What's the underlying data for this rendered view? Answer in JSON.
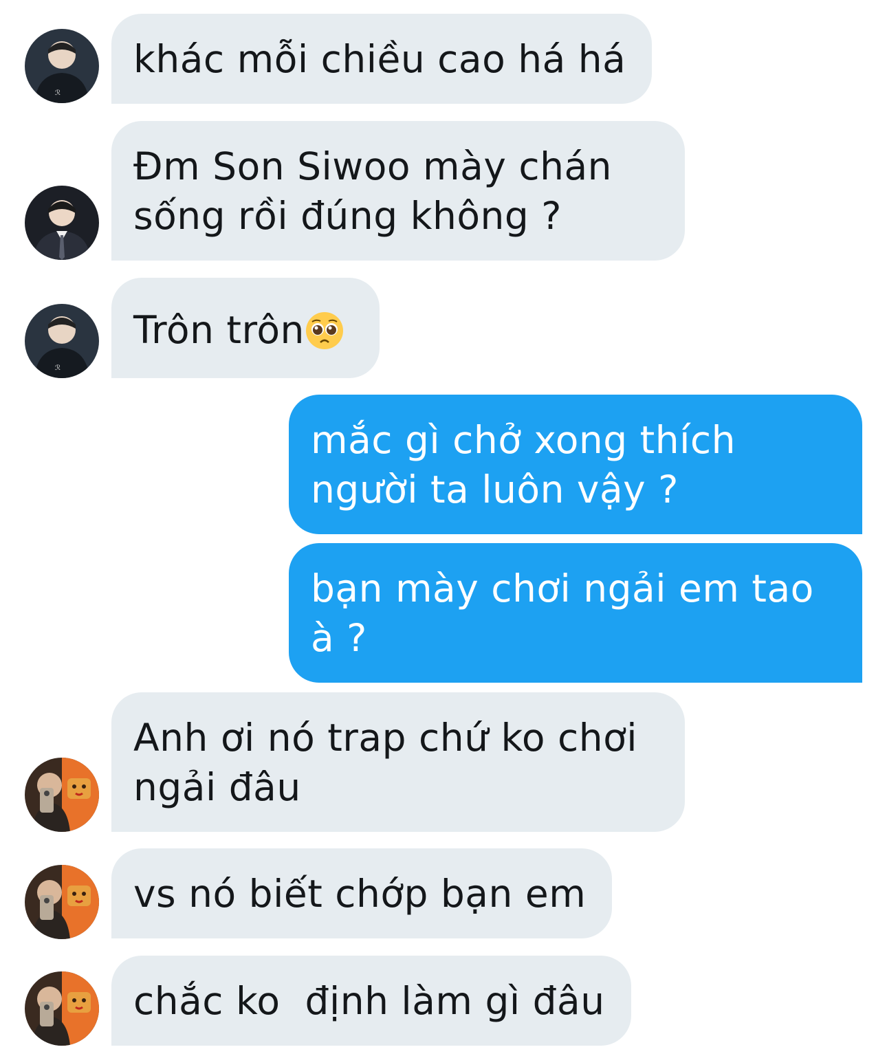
{
  "conversation": {
    "messages": [
      {
        "lines": [
          "khác mỗi chiều cao há há"
        ]
      },
      {
        "lines": [
          "Đm Son Siwoo mày chán",
          "sống rồi đúng không ?"
        ]
      },
      {
        "lines": [
          "Trôn trôn"
        ],
        "emoji": "pleading-face"
      },
      {
        "lines": [
          "mắc gì chở xong thích",
          "người ta luôn vậy ?"
        ]
      },
      {
        "lines": [
          "bạn mày chơi ngải em tao",
          "à ?"
        ]
      },
      {
        "lines": [
          "Anh ơi nó trap chứ ko chơi",
          "ngải đâu"
        ]
      },
      {
        "lines": [
          "vs nó biết chớp bạn em"
        ]
      },
      {
        "lines": [
          "chắc ko  định làm gì đâu"
        ]
      }
    ]
  },
  "colors": {
    "incoming_bubble": "#e6ecf0",
    "outgoing_bubble": "#1da1f2",
    "incoming_text": "#14171a",
    "outgoing_text": "#ffffff"
  }
}
